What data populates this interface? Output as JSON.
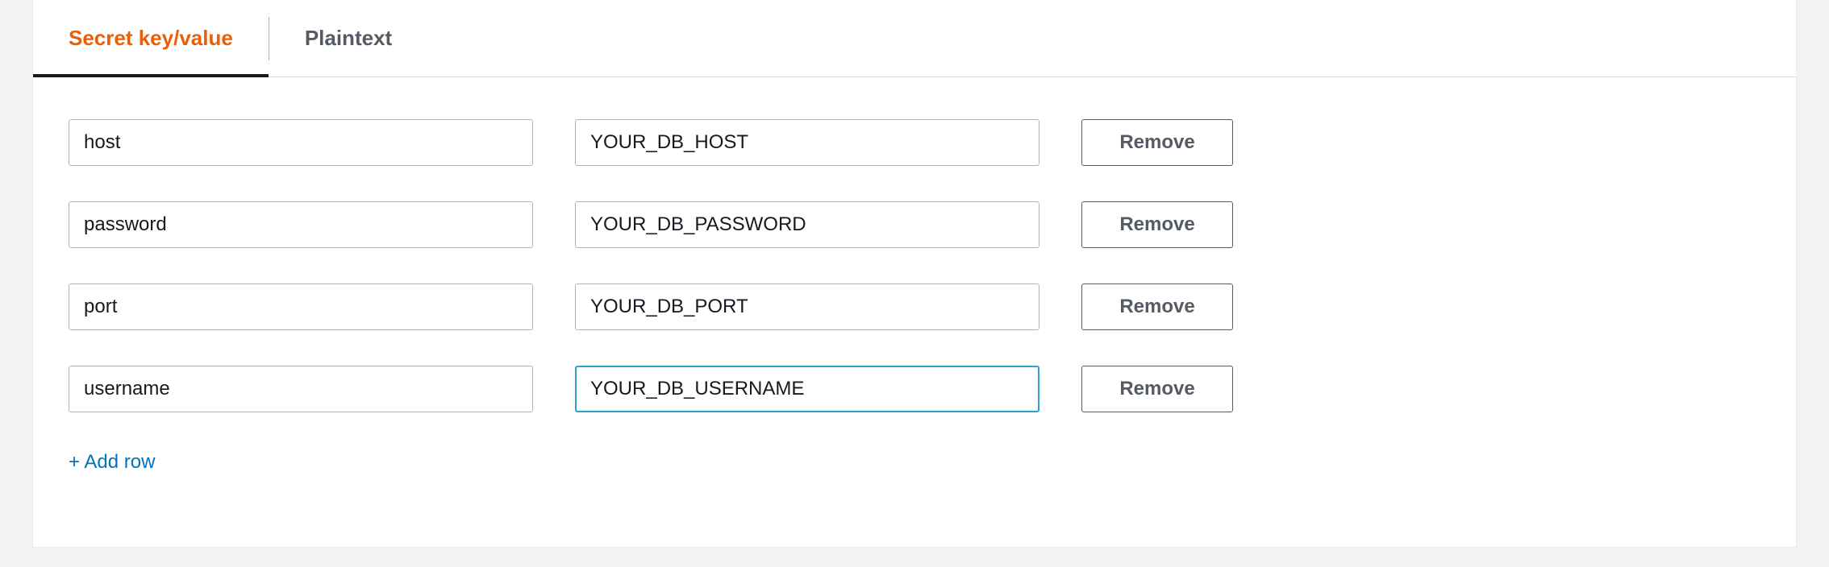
{
  "tabs": {
    "items": [
      {
        "label": "Secret key/value",
        "active": true
      },
      {
        "label": "Plaintext",
        "active": false
      }
    ]
  },
  "rows": [
    {
      "key": "host",
      "value": "YOUR_DB_HOST",
      "focused": false
    },
    {
      "key": "password",
      "value": "YOUR_DB_PASSWORD",
      "focused": false
    },
    {
      "key": "port",
      "value": "YOUR_DB_PORT",
      "focused": false
    },
    {
      "key": "username",
      "value": "YOUR_DB_USERNAME",
      "focused": true
    }
  ],
  "buttons": {
    "remove_label": "Remove",
    "add_row_label": "+ Add row"
  }
}
